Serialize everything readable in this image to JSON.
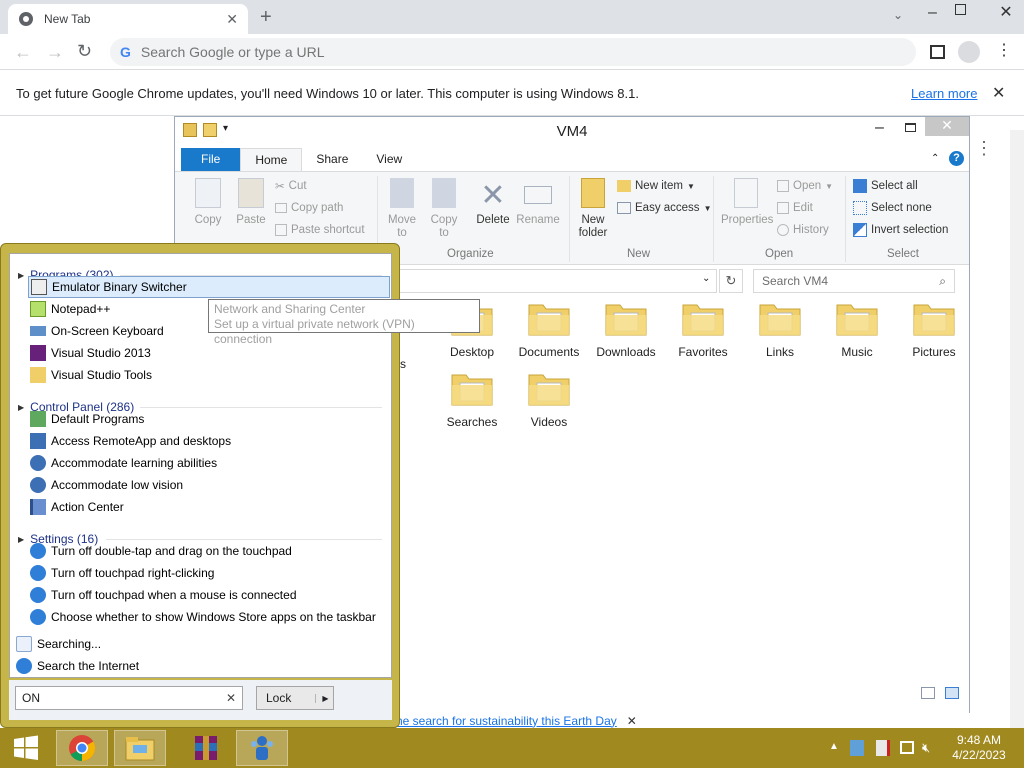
{
  "browser": {
    "tab_title": "New Tab",
    "omnibox_placeholder": "Search Google or type a URL",
    "infobar_text": "To get future Google Chrome updates, you'll need Windows 10 or later. This computer is using Windows 8.1.",
    "infobar_link": "Learn more",
    "bottom_link": "he search for sustainability this Earth Day"
  },
  "explorer": {
    "title": "VM4",
    "tabs": [
      "File",
      "Home",
      "Share",
      "View"
    ],
    "clipboard": {
      "copy": "Copy",
      "paste": "Paste",
      "cut": "Cut",
      "copy_path": "Copy path",
      "paste_shortcut": "Paste shortcut"
    },
    "organize": {
      "move_to_1": "Move",
      "move_to_2": "to",
      "copy_to_1": "Copy",
      "copy_to_2": "to",
      "delete": "Delete",
      "rename": "Rename",
      "label": "Organize"
    },
    "new": {
      "new_folder_1": "New",
      "new_folder_2": "folder",
      "new_item": "New item",
      "easy_access": "Easy access",
      "label": "New"
    },
    "open": {
      "properties": "Properties",
      "open": "Open",
      "edit": "Edit",
      "history": "History",
      "label": "Open"
    },
    "select": {
      "select_all": "Select all",
      "select_none": "Select none",
      "invert": "Invert selection",
      "label": "Select"
    },
    "search_placeholder": "Search VM4",
    "folders": [
      "Desktop",
      "Documents",
      "Downloads",
      "Favorites",
      "Links",
      "Music",
      "Pictures",
      "Searches",
      "Videos"
    ],
    "partial_label": "s"
  },
  "start_search": {
    "programs_header": "Programs (302)",
    "programs": [
      "Emulator Binary Switcher",
      "Notepad++",
      "On-Screen Keyboard",
      "Visual Studio 2013",
      "Visual Studio Tools"
    ],
    "control_header": "Control Panel (286)",
    "control": [
      "Default Programs",
      "Access RemoteApp and desktops",
      "Accommodate learning abilities",
      "Accommodate low vision",
      "Action Center"
    ],
    "settings_header": "Settings (16)",
    "settings": [
      "Turn off double-tap and drag on the touchpad",
      "Turn off touchpad right-clicking",
      "Turn off touchpad when a mouse is connected",
      "Choose whether to show Windows Store apps on the taskbar"
    ],
    "searching": "Searching...",
    "search_internet": "Search the Internet",
    "query": "ON",
    "lock_label": "Lock"
  },
  "tooltip": {
    "line1": "Network and Sharing Center",
    "line2": "Set up a virtual private network (VPN) connection"
  },
  "taskbar": {
    "time": "9:48 AM",
    "date": "4/22/2023"
  }
}
